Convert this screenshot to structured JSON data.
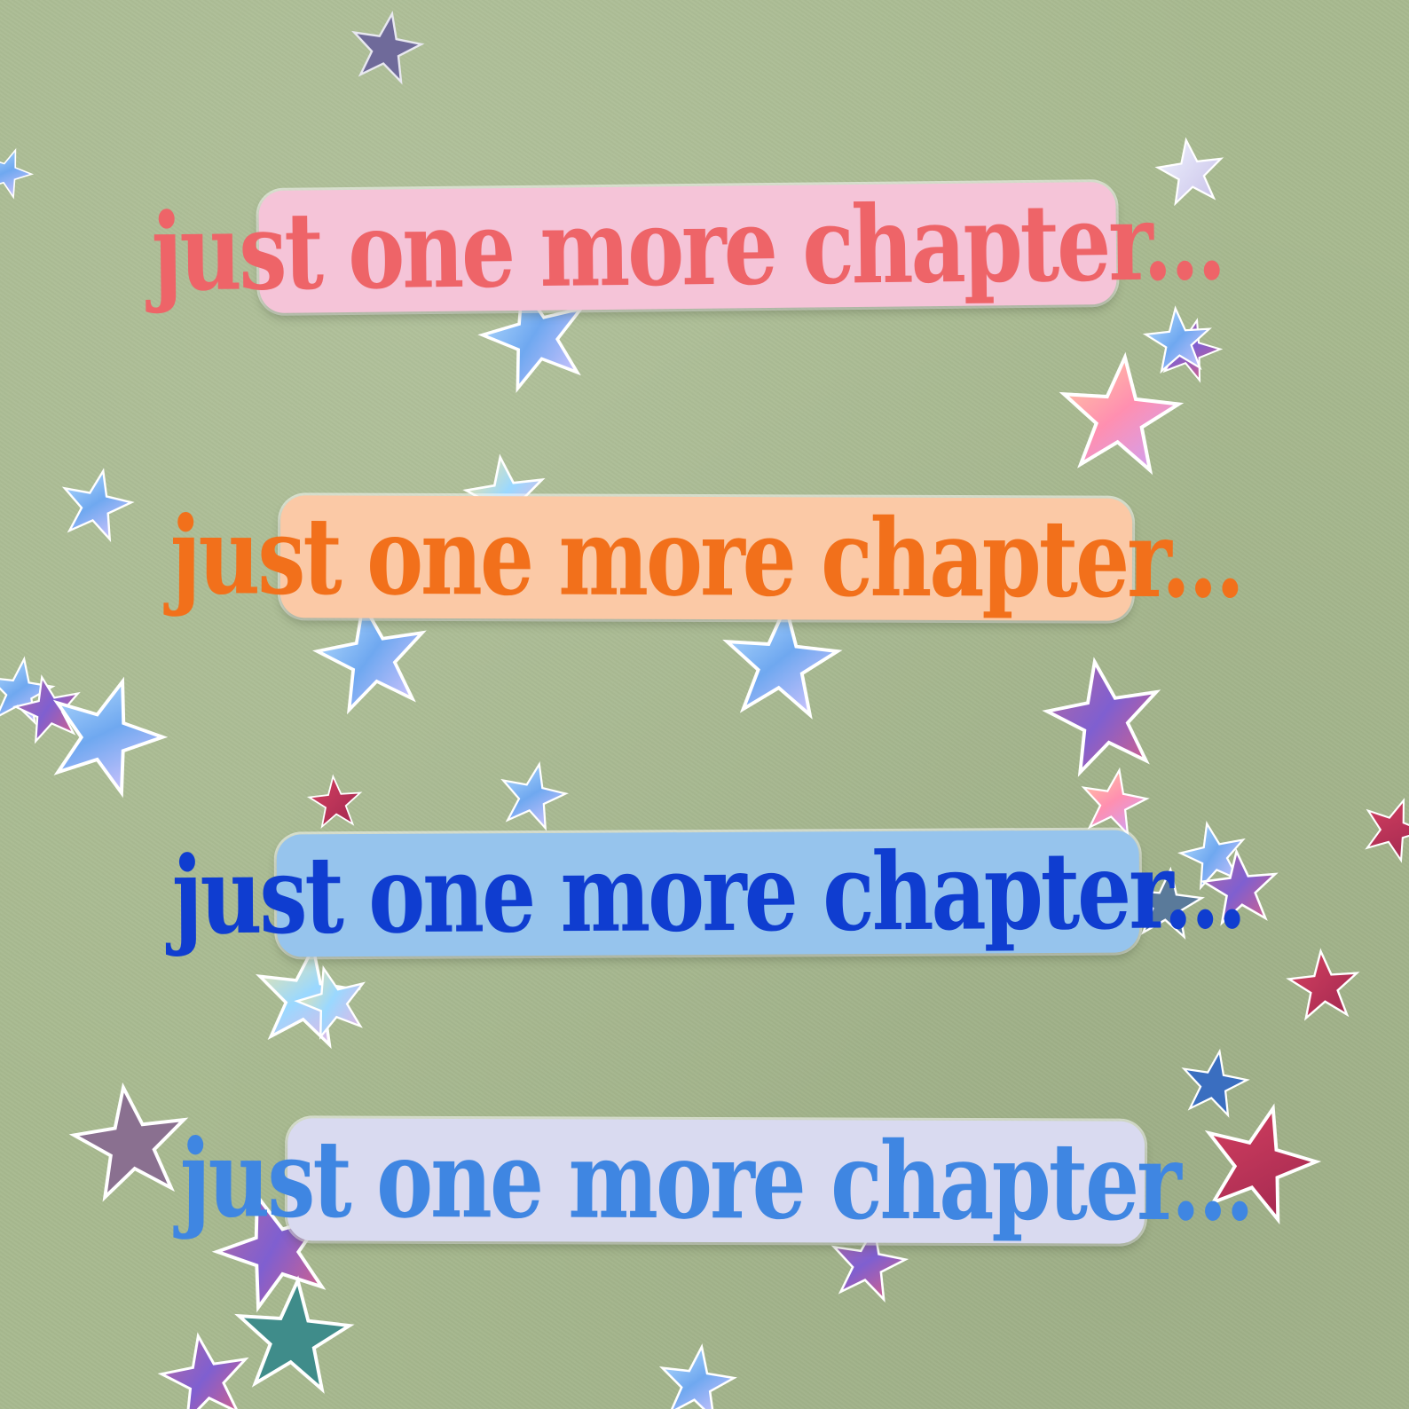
{
  "scene": {
    "background_color": "#a8ba90",
    "stickers": [
      {
        "text": "just one more chapter...",
        "bg_color": "#f5c4d8",
        "text_color": "#ee6468"
      },
      {
        "text": "just one more chapter...",
        "bg_color": "#fbc9a6",
        "text_color": "#f2701b"
      },
      {
        "text": "just one more chapter...",
        "bg_color": "#96c4ed",
        "text_color": "#0f3dd0"
      },
      {
        "text": "just one more chapter...",
        "bg_color": "#d9daf0",
        "text_color": "#3f86e2"
      }
    ],
    "confetti_colors": [
      "#8fc8f0",
      "#c9a6e8",
      "#f0a0c0",
      "#f7b07a",
      "#d04a7a",
      "#5a8fd8",
      "#e8e0f0",
      "#b04a6a"
    ]
  }
}
